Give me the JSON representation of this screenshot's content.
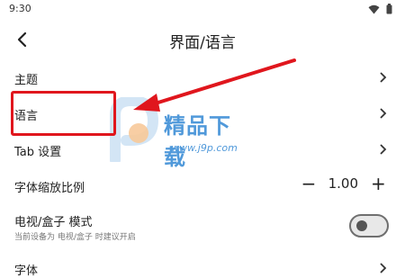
{
  "status": {
    "time": "9:30"
  },
  "header": {
    "title": "界面/语言"
  },
  "rows": {
    "theme": "主题",
    "language": "语言",
    "tab_settings": "Tab 设置",
    "font_scale": {
      "label": "字体缩放比例",
      "value": "1.00",
      "minus": "−",
      "plus": "+"
    },
    "tv_mode": {
      "label": "电视/盒子 模式",
      "sub": "当前设备为 电视/盒子 时建议开启",
      "enabled": false
    },
    "font": "字体"
  },
  "watermark": {
    "brand": "精品下载",
    "url": "www.j9p.com"
  },
  "colors": {
    "annotation": "#e0161d",
    "watermark": "#3e8ed6"
  },
  "icons": [
    "wifi-icon",
    "battery-icon",
    "back-arrow-icon",
    "chevron-right-icon"
  ]
}
